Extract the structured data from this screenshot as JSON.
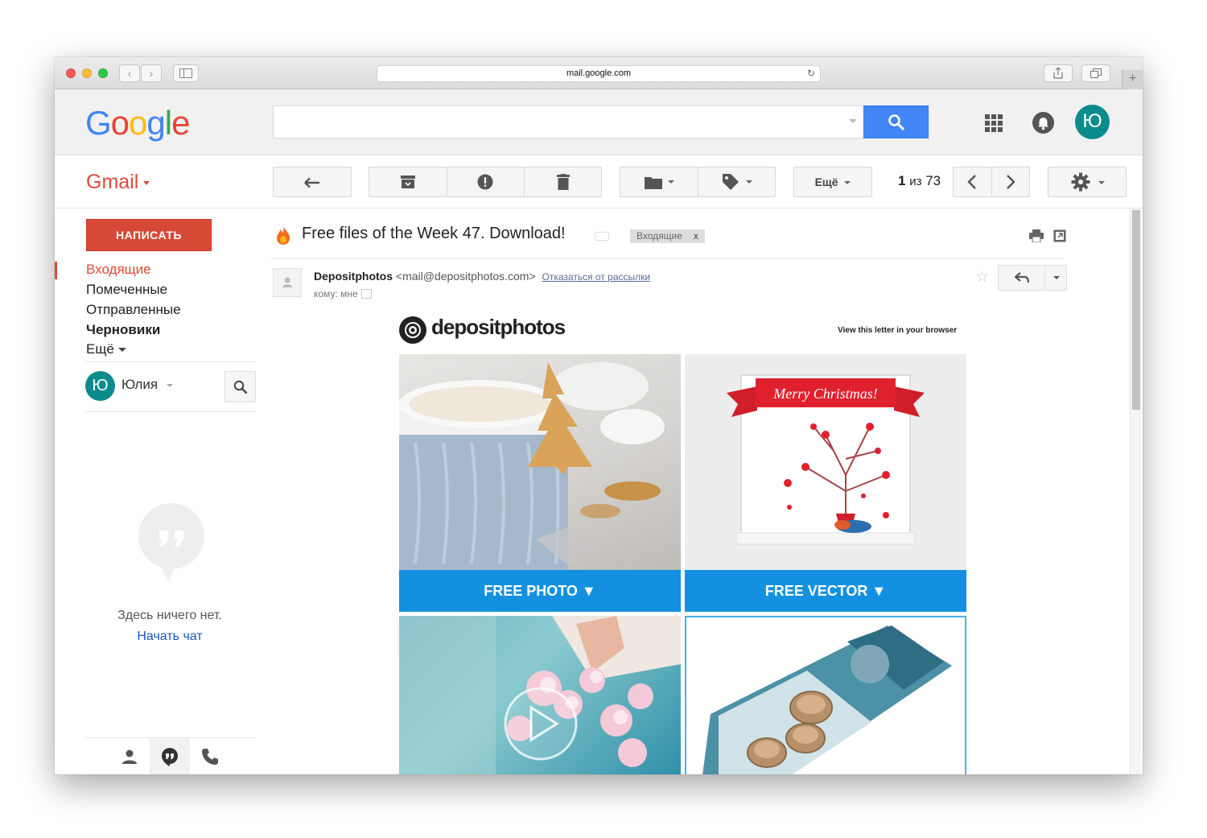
{
  "browser": {
    "url": "mail.google.com"
  },
  "header": {
    "logo_letters": [
      "G",
      "o",
      "o",
      "g",
      "l",
      "e"
    ],
    "avatar_initial": "Ю"
  },
  "toolbar": {
    "gmail_label": "Gmail",
    "more_label": "Ещё",
    "counter_current": "1",
    "counter_sep": "из",
    "counter_total": "73"
  },
  "sidebar": {
    "compose_label": "НАПИСАТЬ",
    "items": [
      {
        "label": "Входящие",
        "active": true
      },
      {
        "label": "Помеченные"
      },
      {
        "label": "Отправленные"
      },
      {
        "label": "Черновики",
        "bold": true
      },
      {
        "label": "Ещё"
      }
    ],
    "hangouts_user_initial": "Ю",
    "hangouts_user_name": "Юлия",
    "empty_text": "Здесь ничего нет.",
    "start_chat": "Начать чат"
  },
  "message": {
    "subject": "Free files of the Week 47. Download!",
    "label_tag": "Входящие",
    "label_close": "x",
    "sender_name": "Depositphotos",
    "sender_email": "<mail@depositphotos.com>",
    "unsubscribe": "Отказаться от рассылки",
    "to_me": "кому: мне"
  },
  "email_body": {
    "brand": "depositphotos",
    "view_link": "View this letter in your browser",
    "card_top_right_text": "Merry Christmas!",
    "button_photo": "FREE PHOTO ▼",
    "button_vector": "FREE VECTOR ▼"
  },
  "colors": {
    "gmail_red": "#dd4b39",
    "search_blue": "#4285f4",
    "avatar_teal": "#0b8c8c",
    "free_button_blue": "#1391e0"
  }
}
